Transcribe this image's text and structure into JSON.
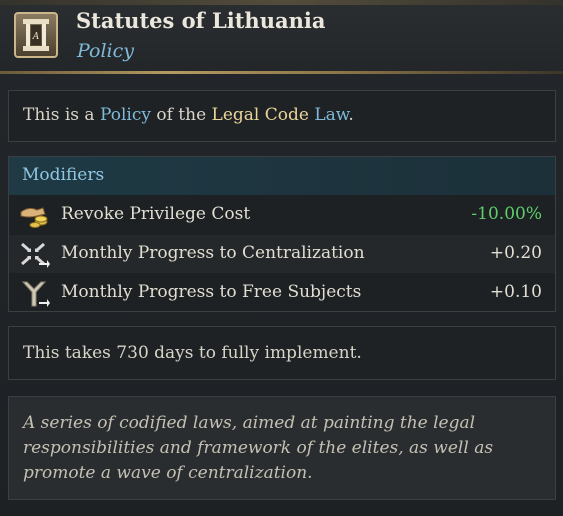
{
  "header": {
    "title": "Statutes of Lithuania",
    "subtitle": "Policy",
    "emblem_icon": "scroll-pillar-icon"
  },
  "description": {
    "prefix": "This is a ",
    "policy_word": "Policy",
    "middle": " of the ",
    "law_name": "Legal Code",
    "space": " ",
    "law_word": "Law",
    "suffix": "."
  },
  "modifiers": {
    "header": "Modifiers",
    "items": [
      {
        "icon": "hand-coins-icon",
        "label": "Revoke Privilege Cost",
        "value": "-10.00%",
        "tone": "good"
      },
      {
        "icon": "centralization-arrows-icon",
        "label": "Monthly Progress to Centralization",
        "value": "+0.20",
        "tone": "neutral"
      },
      {
        "icon": "fork-branch-icon",
        "label": "Monthly Progress to Free Subjects",
        "value": "+0.10",
        "tone": "neutral"
      }
    ]
  },
  "implementation": {
    "text": "This takes 730 days to fully implement."
  },
  "flavor": {
    "text": "A series of codified laws, aimed at painting the legal responsibilities and framework of the elites, as well as promote a wave of centralization."
  },
  "colors": {
    "accent_blue": "#7fbad8",
    "accent_gold": "#ead49a",
    "positive_green": "#5fcf6a",
    "header_rule": "#b49a62"
  }
}
